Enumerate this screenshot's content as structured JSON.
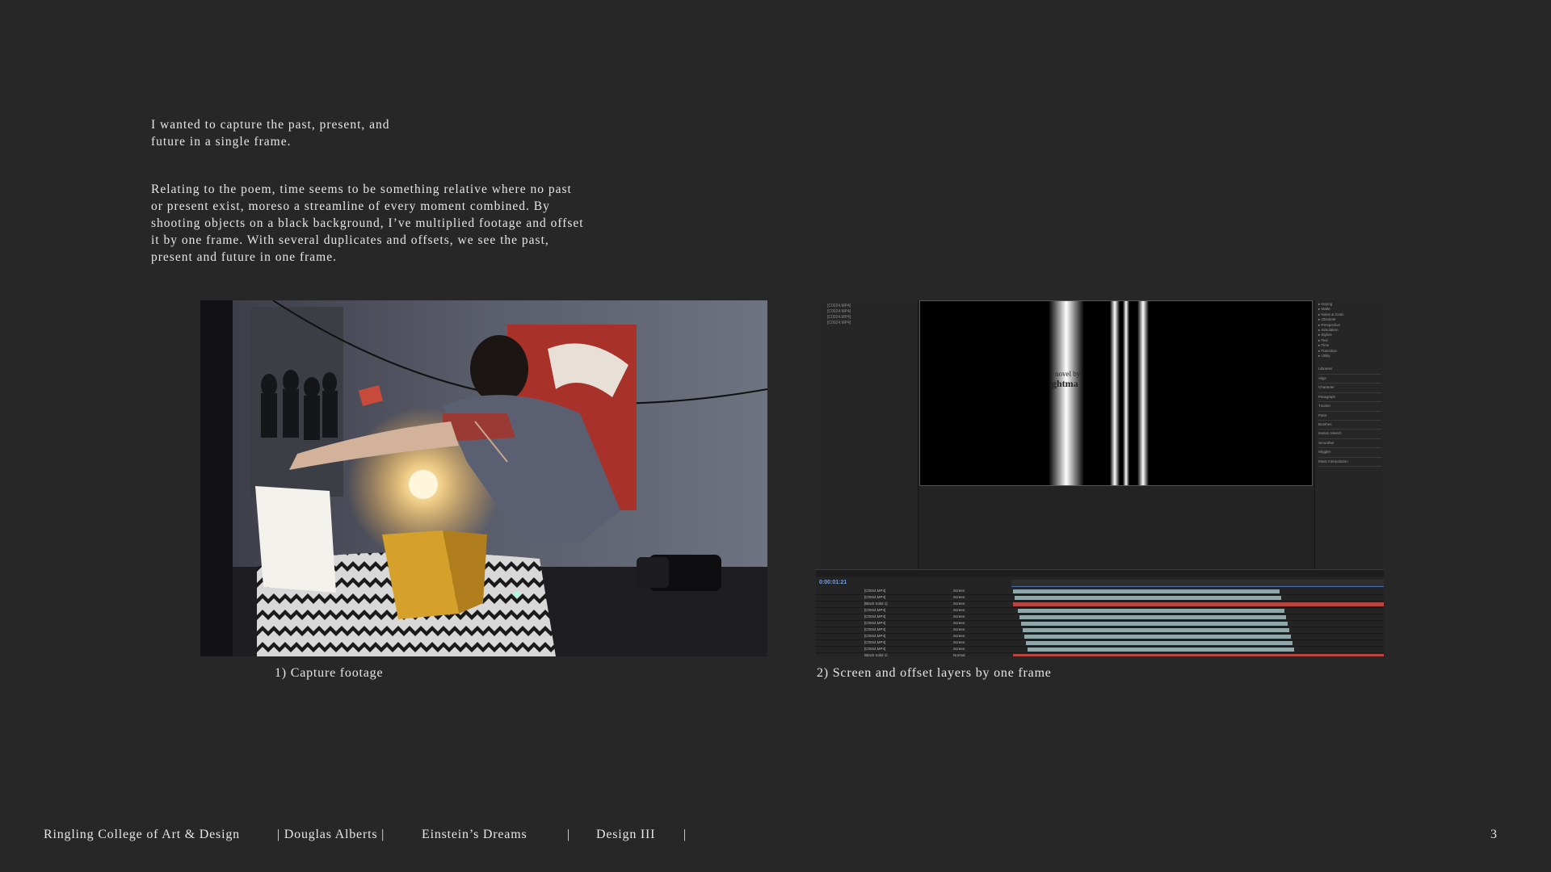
{
  "intro": {
    "line1": "I wanted to capture the past, present, and",
    "line2": "future in a single frame."
  },
  "body": {
    "lines": [
      "Relating to the poem, time seems to be something relative where no past",
      "or present exist, moreso a streamline of every moment combined. By",
      "shooting objects on a black background, I’ve multiplied footage and offset",
      "it by one frame. With several duplicates and offsets, we see the past,",
      "present and future in one frame."
    ]
  },
  "figures": {
    "fig1_caption": "1) Capture footage",
    "fig2_caption": "2) Screen and offset layers by one frame"
  },
  "editor": {
    "timecode": "0:00:01:21",
    "title_fragment_1": "novel by",
    "title_fragment_2": "ghtma",
    "effects_list": [
      "Keying",
      "Matte",
      "Noise & Grain",
      "Obsolete",
      "Perspective",
      "Simulation",
      "Stylize",
      "Text",
      "Time",
      "Transition",
      "Utility"
    ],
    "panels": [
      "Libraries",
      "Align",
      "Character",
      "Paragraph",
      "Tracker",
      "Paint",
      "Brushes",
      "Motion Sketch",
      "Smoother",
      "Wiggler",
      "Mask Interpolation"
    ],
    "layers": [
      "[C0024.MP4]",
      "[C0024.MP4]",
      "[Black Solid 1]",
      "[C0024.MP4]",
      "[C0024.MP4]",
      "[C0024.MP4]",
      "[C0024.MP4]",
      "[C0024.MP4]",
      "[C0024.MP4]",
      "[C0024.MP4]",
      "[Black Solid 1]"
    ],
    "modes": [
      "Screen",
      "Screen",
      "Screen",
      "Screen",
      "Screen",
      "Screen",
      "Screen",
      "Screen",
      "Screen",
      "Screen",
      "Normal"
    ]
  },
  "footer": {
    "school": "Ringling College of Art & Design",
    "author": "| Douglas Alberts |",
    "project": "Einstein’s Dreams",
    "sep1": "|",
    "course": "Design III",
    "sep2": "|",
    "page": "3"
  },
  "colors": {
    "background": "#272727",
    "text": "#e6e6e6",
    "poster_red": "#a8322a",
    "suitcase_yellow": "#d6a12a",
    "timeline_teal": "#8fa7a8",
    "timeline_red": "#b8453f"
  }
}
